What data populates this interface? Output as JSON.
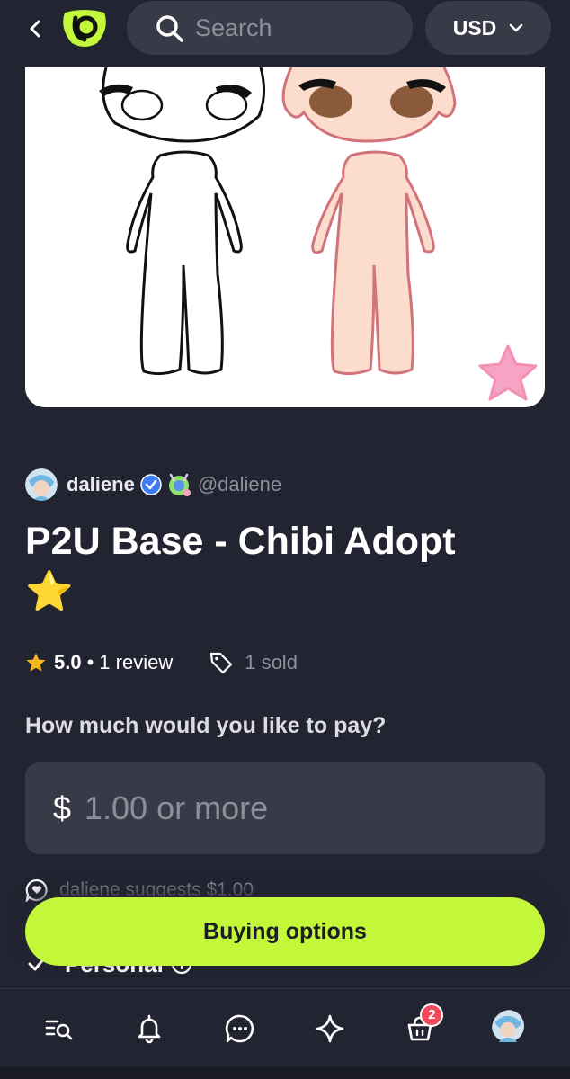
{
  "header": {
    "search_placeholder": "Search",
    "currency": "USD",
    "icons": [
      "chevron-left-icon",
      "logo",
      "search-icon",
      "chevron-down-icon"
    ]
  },
  "seller": {
    "name": "daliene",
    "handle": "@daliene"
  },
  "product": {
    "title": "P2U Base - Chibi Adopt",
    "title_emoji": "⭐",
    "rating": "5.0",
    "separator": "•",
    "review_count": "1 review",
    "sold_count": "1 sold"
  },
  "pricing": {
    "question": "How much would you like to pay?",
    "currency_symbol": "$",
    "placeholder": "1.00 or more",
    "suggestion": "daliene suggests $1.00"
  },
  "options": {
    "first_option_label": "Personal"
  },
  "buy_button_label": "Buying options",
  "bottom_nav": {
    "cart_badge": "2",
    "items": [
      "discover-icon",
      "bell-icon",
      "chat-icon",
      "sparkle-icon",
      "cart-icon",
      "avatar"
    ]
  },
  "colors": {
    "background": "#232431",
    "surface": "#393a47",
    "accent": "#c3f73a",
    "muted_text": "#8e8f9a",
    "badge": "#f24a5a"
  }
}
